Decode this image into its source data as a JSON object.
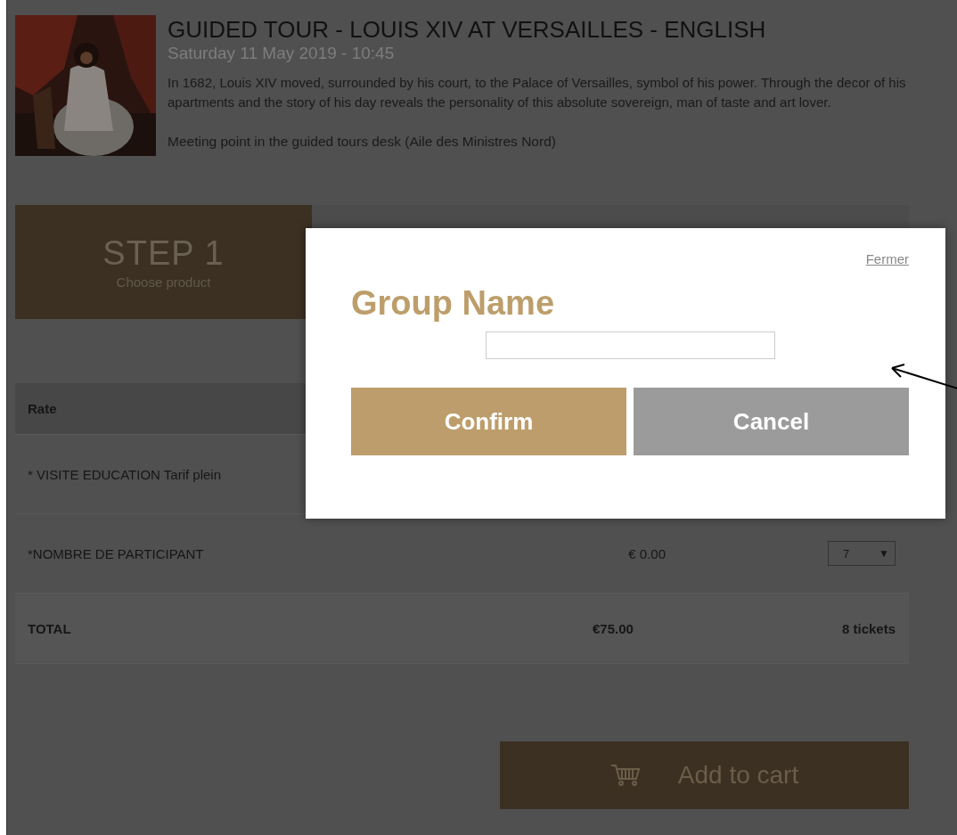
{
  "event": {
    "title": "GUIDED TOUR - LOUIS XIV AT VERSAILLES - ENGLISH",
    "date": "Saturday 11 May 2019 - 10:45",
    "description": "In 1682, Louis XIV moved, surrounded by his court, to the Palace of Versailles, symbol of his power. Through the decor of his apartments and the story of his day reveals the personality of this absolute sovereign, man of taste and art lover.",
    "meeting_point": "Meeting point in the guided tours desk (Aile des Ministres Nord)"
  },
  "steps": [
    {
      "title": "STEP 1",
      "subtitle": "Choose product"
    }
  ],
  "table": {
    "columns": [
      "Rate"
    ],
    "rows": [
      {
        "rate": "* VISITE EDUCATION Tarif plein"
      },
      {
        "rate": "*NOMBRE DE PARTICIPANT",
        "price": "€ 0.00",
        "quantity": "7",
        "caret": "▼"
      }
    ],
    "total": {
      "label": "TOTAL",
      "amount": "€75.00",
      "tickets": "8 tickets"
    }
  },
  "add_to_cart": "Add to cart",
  "modal": {
    "close": "Fermer",
    "title": "Group Name",
    "buttons": [
      {
        "label": "Confirm",
        "kind": "confirm"
      },
      {
        "label": "Cancel",
        "kind": "cancel"
      }
    ]
  }
}
